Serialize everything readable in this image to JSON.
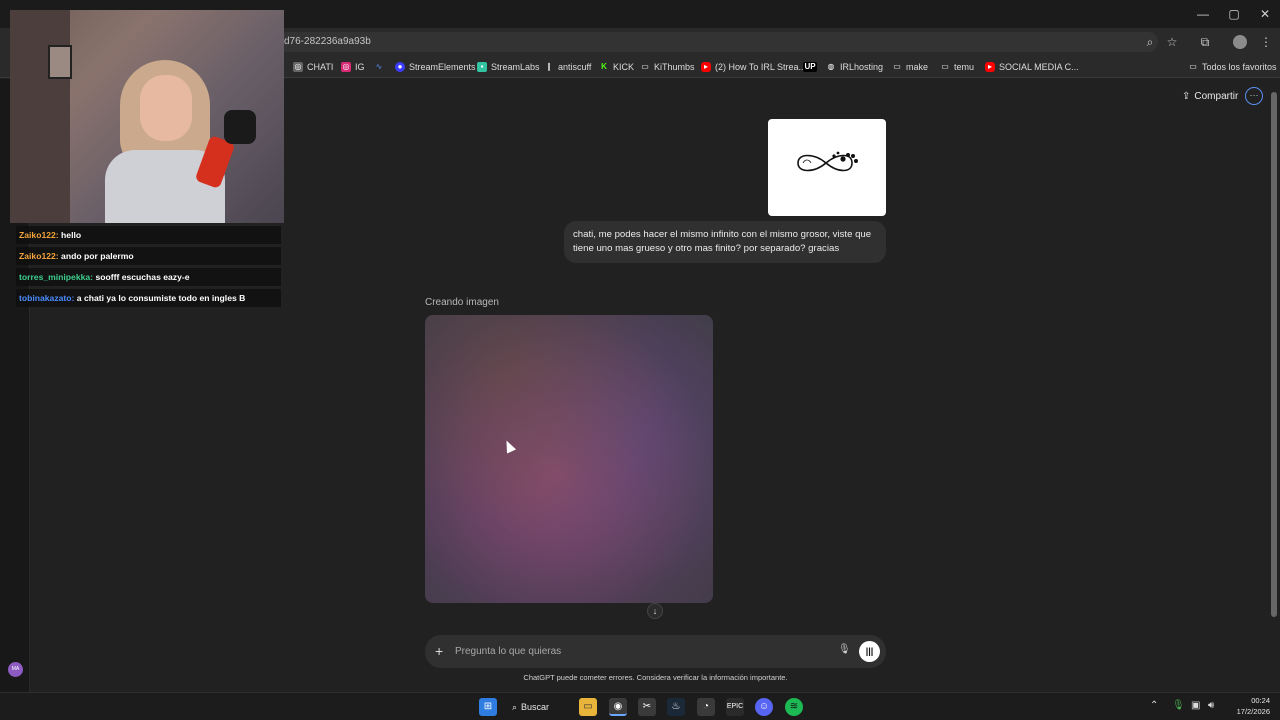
{
  "browser": {
    "url": "d76-282236a9a93b",
    "window_controls": {
      "minimize": "—",
      "maximize": "▢",
      "close": "✕"
    }
  },
  "bookmarks": [
    {
      "label": "CHATI",
      "icon": "chatgpt-icon",
      "color": "#10a37f"
    },
    {
      "label": "IG",
      "icon": "instagram-icon",
      "color": "#d62976"
    },
    {
      "label": "",
      "icon": "chart-icon",
      "color": "#5b8def"
    },
    {
      "label": "StreamElements",
      "icon": "streamelements-icon",
      "color": "#3c3cff"
    },
    {
      "label": "StreamLabs",
      "icon": "streamlabs-icon",
      "color": "#31c3a2"
    },
    {
      "label": "antiscuff",
      "icon": "antiscuff-icon",
      "color": "#8a8a8a"
    },
    {
      "label": "KICK",
      "icon": "kick-icon",
      "color": "#53fc18"
    },
    {
      "label": "KiThumbs",
      "icon": "kithumbs-icon",
      "color": "#8a8a8a"
    },
    {
      "label": "(2) How To IRL Strea...",
      "icon": "youtube-icon",
      "color": "#ff0000"
    },
    {
      "label": "",
      "icon": "up-icon",
      "color": "#ffffff"
    },
    {
      "label": "IRLhosting",
      "icon": "globe-icon",
      "color": "#8a8a8a"
    },
    {
      "label": "make",
      "icon": "folder-icon",
      "color": "#8a8a8a"
    },
    {
      "label": "temu",
      "icon": "folder-icon",
      "color": "#8a8a8a"
    },
    {
      "label": "SOCIAL MEDIA C...",
      "icon": "youtube-icon",
      "color": "#ff0000"
    }
  ],
  "bookmarks_right": {
    "label": "Todos los favoritos",
    "icon": "folder-icon"
  },
  "header": {
    "share_label": "Compartir"
  },
  "conversation": {
    "user_message": "chati, me podes hacer el mismo infinito con el mismo grosor, viste que tiene uno mas grueso y otro mas finito? por separado? gracias",
    "status": "Creando imagen"
  },
  "composer": {
    "placeholder": "Pregunta lo que quieras",
    "disclaimer": "ChatGPT puede cometer errores. Considera verificar la información importante."
  },
  "stream_chat": [
    {
      "user": "Zaiko122:",
      "message": "hello",
      "color": "#f2a33a"
    },
    {
      "user": "Zaiko122:",
      "message": "ando por palermo",
      "color": "#f2a33a"
    },
    {
      "user": "torres_minipekka:",
      "message": "soofff escuchas eazy-e",
      "color": "#3ecf8e"
    },
    {
      "user": "tobinakazato:",
      "message": "a chati ya lo consumiste todo en ingles B",
      "color": "#4a8cff"
    }
  ],
  "taskbar": {
    "search_label": "Buscar",
    "time": "00:24",
    "date": "17/2/2026"
  },
  "avatar_initials": "MA"
}
